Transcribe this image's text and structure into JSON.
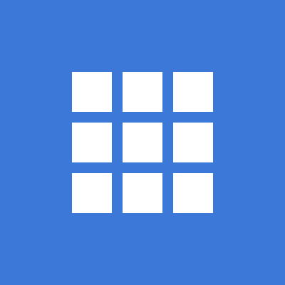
{
  "icon": {
    "name": "apps-grid-icon",
    "background_color": "#3B78D8",
    "tile_color": "#FFFFFF",
    "rows": 3,
    "columns": 3
  }
}
